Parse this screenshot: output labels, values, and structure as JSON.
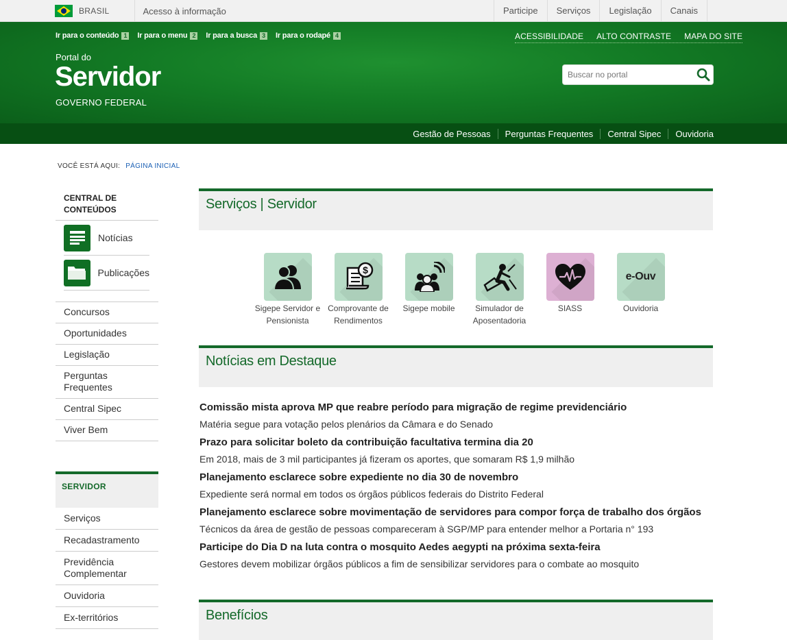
{
  "gov_bar": {
    "brasil_label": "BRASIL",
    "acesso_label": "Acesso à informação",
    "links": [
      "Participe",
      "Serviços",
      "Legislação",
      "Canais"
    ]
  },
  "header": {
    "skip_links": [
      {
        "label": "Ir para o conteúdo",
        "key": "1"
      },
      {
        "label": "Ir para o menu",
        "key": "2"
      },
      {
        "label": "Ir para a busca",
        "key": "3"
      },
      {
        "label": "Ir para o rodapé",
        "key": "4"
      }
    ],
    "accessibility_links": [
      "ACESSIBILIDADE",
      "ALTO CONTRASTE",
      "MAPA DO SITE"
    ],
    "portal_do": "Portal do",
    "site_title": "Servidor",
    "subtitle": "GOVERNO FEDERAL",
    "search_placeholder": "Buscar no portal"
  },
  "menu_bar": {
    "links": [
      "Gestão de Pessoas",
      "Perguntas Frequentes",
      "Central Sipec",
      "Ouvidoria"
    ]
  },
  "breadcrumb": {
    "prefix": "VOCÊ ESTÁ AQUI:",
    "current": "PÁGINA INICIAL"
  },
  "sidebar": {
    "central_heading": "CENTRAL DE CONTEÚDOS",
    "icon_items": [
      {
        "label": "Notícias",
        "icon": "news-icon"
      },
      {
        "label": "Publicações",
        "icon": "folder-icon"
      }
    ],
    "list": [
      "Concursos",
      "Oportunidades",
      "Legislação",
      "Perguntas Frequentes",
      "Central Sipec",
      "Viver Bem"
    ],
    "servidor_heading": "SERVIDOR",
    "servidor_list": [
      "Serviços",
      "Recadastramento",
      "Previdência Complementar",
      "Ouvidoria",
      "Ex-territórios"
    ]
  },
  "main": {
    "services_heading": "Serviços | Servidor",
    "services": [
      {
        "label": "Sigepe Servidor e Pensionista",
        "icon": "users-icon"
      },
      {
        "label": "Comprovante de Rendimentos",
        "icon": "receipt-icon"
      },
      {
        "label": "Sigepe mobile",
        "icon": "mobile-users-icon"
      },
      {
        "label": "Simulador de Aposentadoria",
        "icon": "retiree-icon"
      },
      {
        "label": "SIASS",
        "icon": "heart-pulse-icon"
      },
      {
        "label": "Ouvidoria",
        "icon": "e-ouv-icon",
        "tile_text": "e-Ouv"
      }
    ],
    "news_heading": "Notícias em Destaque",
    "news": [
      {
        "title": "Comissão mista aprova MP que reabre período para migração de regime previdenciário",
        "summary": "Matéria segue para votação pelos plenários da Câmara e do Senado"
      },
      {
        "title": "Prazo para solicitar boleto da contribuição facultativa termina dia 20",
        "summary": "Em 2018, mais de 3 mil participantes já fizeram os aportes, que somaram R$ 1,9 milhão"
      },
      {
        "title": "Planejamento esclarece sobre expediente no dia 30 de novembro",
        "summary": "Expediente será normal em todos os órgãos públicos federais do Distrito Federal"
      },
      {
        "title": "Planejamento esclarece sobre movimentação de servidores para compor força de trabalho dos órgãos",
        "summary": "Técnicos da área de gestão de pessoas compareceram à SGP/MP para entender melhor a Portaria n° 193"
      },
      {
        "title": "Participe do Dia D na luta contra o mosquito Aedes aegypti na próxima sexta-feira",
        "summary": "Gestores devem mobilizar órgãos públicos a fim de sensibilizar servidores para o combate ao mosquito"
      }
    ],
    "benefits_heading": "Benefícios"
  },
  "colors": {
    "header_green": "#137b25",
    "menu_green": "#074f13",
    "accent_green": "#14692a",
    "tile_green": "#b7dcc6",
    "tile_pink": "#ddb0d3"
  }
}
